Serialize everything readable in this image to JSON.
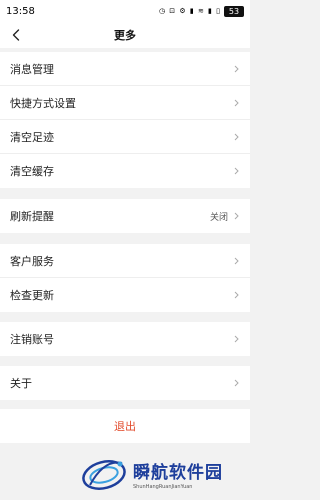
{
  "status_bar": {
    "time": "13:58",
    "icons": "◷ ⊡ ⚙ ▮ ≋ ▮ ▯",
    "battery": "53"
  },
  "header": {
    "back_icon": "chevron-left-icon",
    "title": "更多"
  },
  "group1": {
    "items": [
      {
        "label": "消息管理"
      },
      {
        "label": "快捷方式设置"
      },
      {
        "label": "清空足迹"
      },
      {
        "label": "清空缓存"
      }
    ]
  },
  "group2": {
    "items": [
      {
        "label": "刷新提醒",
        "value": "关闭"
      }
    ]
  },
  "group3": {
    "items": [
      {
        "label": "客户服务"
      },
      {
        "label": "检查更新"
      }
    ]
  },
  "group4": {
    "items": [
      {
        "label": "注销账号"
      }
    ]
  },
  "group5": {
    "items": [
      {
        "label": "关于"
      }
    ]
  },
  "logout": {
    "label": "退出"
  },
  "watermark": {
    "name": "瞬航软件园",
    "pinyin": "ShunHangRuanJianYuan"
  },
  "colors": {
    "logout": "#e24b2c",
    "background": "#f2f2f2",
    "watermark": "#1e3f9c"
  }
}
